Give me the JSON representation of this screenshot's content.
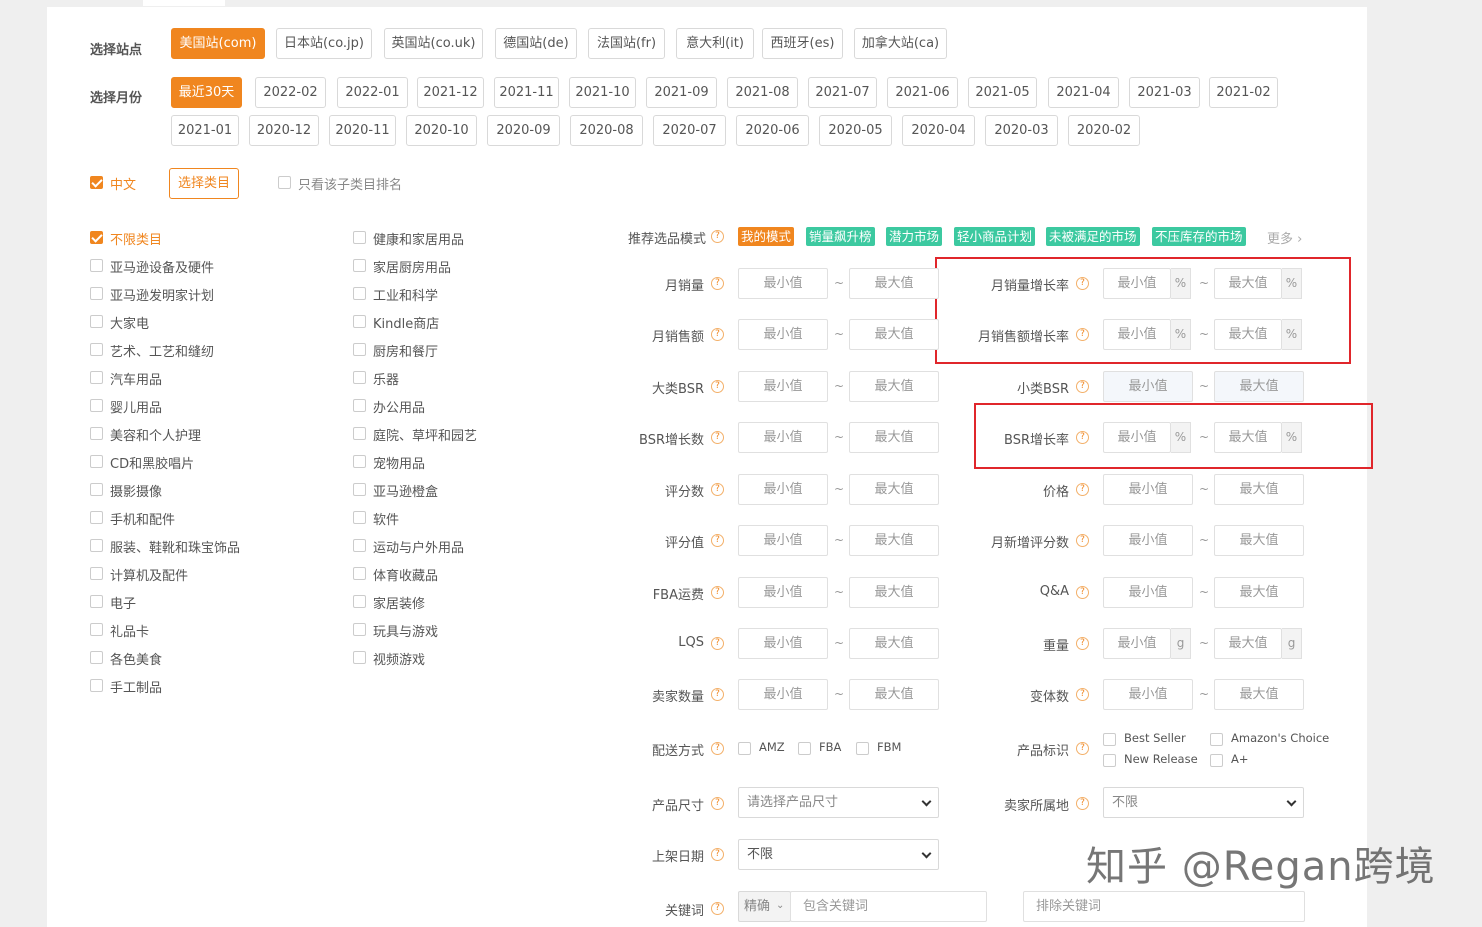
{
  "station": {
    "label": "选择站点",
    "options": [
      "美国站(com)",
      "日本站(co.jp)",
      "英国站(co.uk)",
      "德国站(de)",
      "法国站(fr)",
      "意大利(it)",
      "西班牙(es)",
      "加拿大站(ca)"
    ],
    "selected": "美国站(com)"
  },
  "month": {
    "label": "选择月份",
    "options": [
      "最近30天",
      "2022-02",
      "2022-01",
      "2021-12",
      "2021-11",
      "2021-10",
      "2021-09",
      "2021-08",
      "2021-07",
      "2021-06",
      "2021-05",
      "2021-04",
      "2021-03",
      "2021-02",
      "2021-01",
      "2020-12",
      "2020-11",
      "2020-10",
      "2020-09",
      "2020-08",
      "2020-07",
      "2020-06",
      "2020-05",
      "2020-04",
      "2020-03",
      "2020-02"
    ],
    "selected": "最近30天"
  },
  "lang": {
    "chinese_label": "中文",
    "select_category_button": "选择类目",
    "subcategory_only_label": "只看该子类目排名"
  },
  "categories": {
    "col1": [
      "不限类目",
      "亚马逊设备及硬件",
      "亚马逊发明家计划",
      "大家电",
      "艺术、工艺和缝纫",
      "汽车用品",
      "婴儿用品",
      "美容和个人护理",
      "CD和黑胶唱片",
      "摄影摄像",
      "手机和配件",
      "服装、鞋靴和珠宝饰品",
      "计算机及配件",
      "电子",
      "礼品卡",
      "各色美食",
      "手工制品"
    ],
    "col2": [
      "健康和家居用品",
      "家居厨房用品",
      "工业和科学",
      "Kindle商店",
      "厨房和餐厅",
      "乐器",
      "办公用品",
      "庭院、草坪和园艺",
      "宠物用品",
      "亚马逊橙盒",
      "软件",
      "运动与户外用品",
      "体育收藏品",
      "家居装修",
      "玩具与游戏",
      "视频游戏"
    ]
  },
  "mode": {
    "label": "推荐选品模式",
    "tags": [
      "我的模式",
      "销量飙升榜",
      "潜力市场",
      "轻小商品计划",
      "未被满足的市场",
      "不压库存的市场"
    ],
    "tag_colors": [
      "#f0861f",
      "#3cc9a0",
      "#3cc9a0",
      "#3cc9a0",
      "#3cc9a0",
      "#3cc9a0"
    ],
    "more": "更多"
  },
  "placeholders": {
    "min": "最小值",
    "max": "最大值"
  },
  "filters": {
    "left": [
      "月销量",
      "月销售额",
      "大类BSR",
      "BSR增长数",
      "评分数",
      "评分值",
      "FBA运费",
      "LQS",
      "卖家数量"
    ],
    "right": [
      "月销量增长率",
      "月销售额增长率",
      "小类BSR",
      "BSR增长率",
      "价格",
      "月新增评分数",
      "Q&A",
      "重量",
      "变体数"
    ],
    "right_units": [
      "%",
      "%",
      "",
      "%",
      "",
      "",
      "",
      "g",
      ""
    ]
  },
  "delivery": {
    "label": "配送方式",
    "options": [
      "AMZ",
      "FBA",
      "FBM"
    ]
  },
  "product_tags": {
    "label": "产品标识",
    "options": [
      "Best Seller",
      "Amazon's Choice",
      "New Release",
      "A+"
    ]
  },
  "size": {
    "label": "产品尺寸",
    "value": "请选择产品尺寸"
  },
  "seller_loc": {
    "label": "卖家所属地",
    "value": "不限"
  },
  "listing_date": {
    "label": "上架日期",
    "value": "不限"
  },
  "keyword": {
    "label": "关键词",
    "match": "精确",
    "include_placeholder": "包含关键词",
    "exclude_placeholder": "排除关键词"
  },
  "watermark": "知乎 @Regan跨境"
}
